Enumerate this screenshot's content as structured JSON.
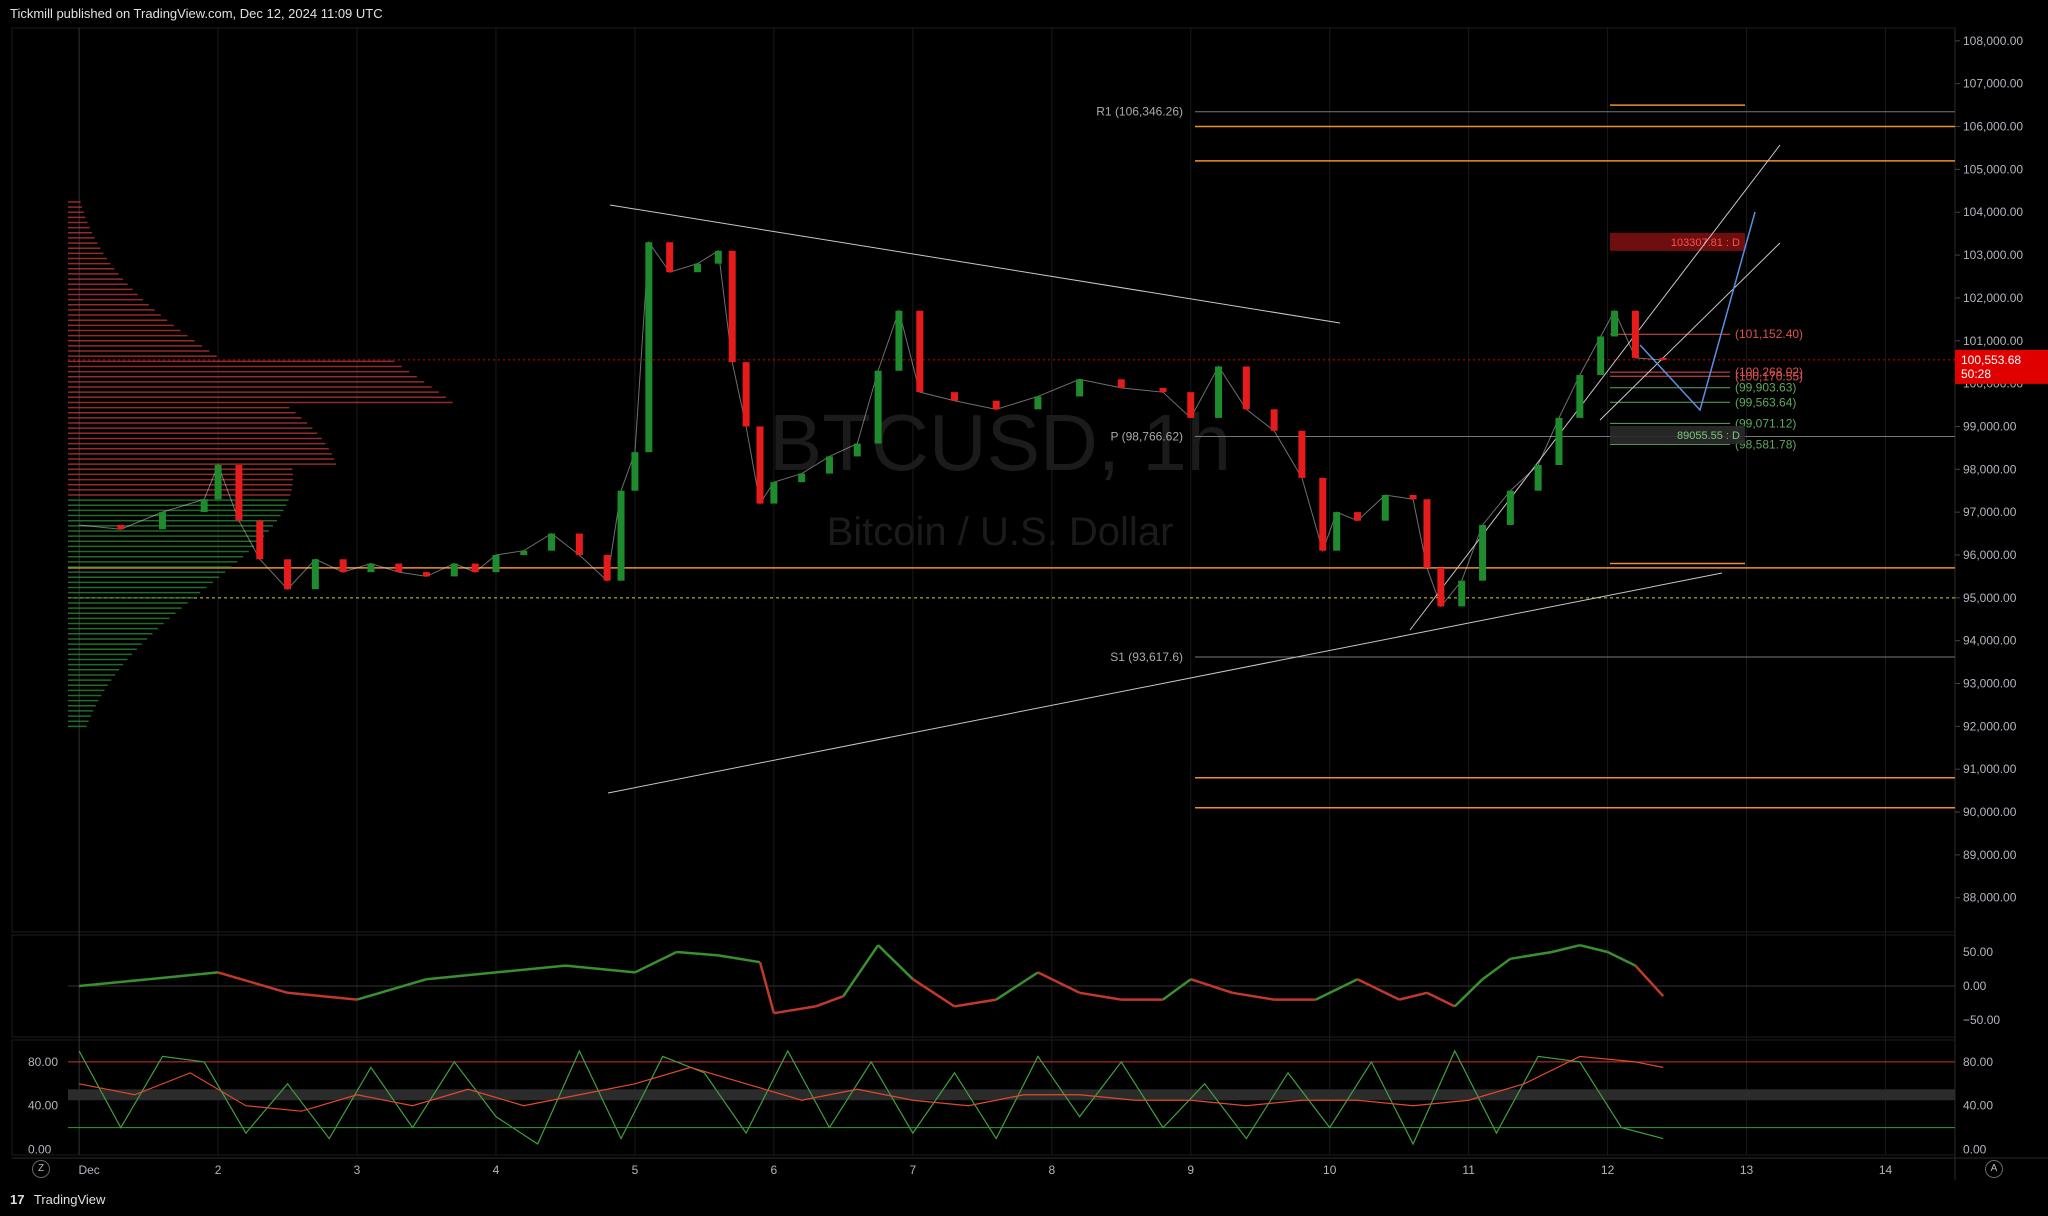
{
  "header": {
    "published": "Tickmill published on TradingView.com, Dec 12, 2024 11:09 UTC"
  },
  "footer": {
    "brand": "TradingView"
  },
  "buttons": {
    "left": "Z",
    "right": "A"
  },
  "colors": {
    "bull": "#1e8c2d",
    "bear": "#e61b1b",
    "price_tag": "#e00000",
    "grid": "#1a1a1a",
    "text": "#b2b5be",
    "orange": "#f0902c",
    "yellow": "#f5c518"
  },
  "chart_data": [
    {
      "type": "line",
      "title": "",
      "watermark": {
        "symbol": "BTCUSD, 1h",
        "name": "Bitcoin / U.S. Dollar"
      },
      "y_ticks": [
        88000,
        89000,
        90000,
        91000,
        92000,
        93000,
        94000,
        95000,
        96000,
        97000,
        98000,
        99000,
        100000,
        101000,
        102000,
        103000,
        104000,
        105000,
        106000,
        107000,
        108000
      ],
      "y_tick_labels": [
        "88,000.00",
        "89,000.00",
        "90,000.00",
        "91,000.00",
        "92,000.00",
        "93,000.00",
        "94,000.00",
        "95,000.00",
        "96,000.00",
        "97,000.00",
        "98,000.00",
        "99,000.00",
        "100,000.00",
        "101,000.00",
        "102,000.00",
        "103,000.00",
        "104,000.00",
        "105,000.00",
        "106,000.00",
        "107,000.00",
        "108,000.00"
      ],
      "ylim": [
        87200,
        108300
      ],
      "x_ticks": [
        "Dec",
        "2",
        "3",
        "4",
        "5",
        "6",
        "7",
        "8",
        "9",
        "10",
        "11",
        "12",
        "13",
        "14"
      ],
      "x_tick_days": [
        1,
        2,
        3,
        4,
        5,
        6,
        7,
        8,
        9,
        10,
        11,
        12,
        13,
        14
      ],
      "xlim": [
        0.92,
        14.5
      ],
      "last_price": {
        "value": 100553.68,
        "label": "100,553.68",
        "countdown": "50:28"
      },
      "series": [
        {
          "x": [
            1.0,
            1.3,
            1.6,
            1.9,
            2.0,
            2.15,
            2.3,
            2.5,
            2.7,
            2.9,
            3.1,
            3.3,
            3.5,
            3.7,
            3.85,
            4.0,
            4.2,
            4.4,
            4.6,
            4.8,
            4.9,
            5.0,
            5.1,
            5.25,
            5.45,
            5.6,
            5.7,
            5.8,
            5.9,
            6.0,
            6.2,
            6.4,
            6.6,
            6.75,
            6.9,
            7.05,
            7.3,
            7.6,
            7.9,
            8.2,
            8.5,
            8.8,
            9.0,
            9.2,
            9.4,
            9.6,
            9.8,
            9.95,
            10.05,
            10.2,
            10.4,
            10.6,
            10.7,
            10.8,
            10.95,
            11.1,
            11.3,
            11.5,
            11.65,
            11.8,
            11.95,
            12.05,
            12.2,
            12.4
          ],
          "values": [
            96700,
            96600,
            97000,
            97300,
            98100,
            96800,
            95900,
            95200,
            95900,
            95600,
            95800,
            95600,
            95500,
            95800,
            95600,
            96000,
            96100,
            96500,
            96000,
            95400,
            97500,
            98400,
            103300,
            102600,
            102800,
            103100,
            100500,
            99000,
            97200,
            97700,
            97900,
            98300,
            98600,
            100300,
            101700,
            99800,
            99600,
            99400,
            99700,
            100100,
            99900,
            99800,
            99200,
            100400,
            99400,
            98900,
            97800,
            96100,
            97000,
            96800,
            97400,
            97300,
            95700,
            94800,
            95400,
            96700,
            97500,
            98100,
            99200,
            100200,
            101100,
            101700,
            100600,
            100550
          ]
        }
      ],
      "levels": [
        {
          "label": "R1 (106,346.26)",
          "value": 106346.26
        },
        {
          "label": "P (98,766.62)",
          "value": 98766.62
        },
        {
          "label": "S1 (93,617.6)",
          "value": 93617.6
        },
        {
          "label": "(101,152.40)",
          "value": 101152.4
        },
        {
          "label": "(100,268.02)",
          "value": 100268.02
        },
        {
          "label": "(100,170.55)",
          "value": 100170.55
        },
        {
          "label": "(99,903.63)",
          "value": 99903.63
        },
        {
          "label": "(99,563.64)",
          "value": 99563.64
        },
        {
          "label": "(99,071.12)",
          "value": 99071.12
        },
        {
          "label": "(98,581.78)",
          "value": 98581.78
        },
        {
          "label": "103307.81 : D",
          "value": 103307.81
        },
        {
          "label": "89055.55 : D",
          "value": 98800
        }
      ]
    },
    {
      "type": "line",
      "y_ticks": [
        50,
        0,
        -50
      ],
      "y_tick_labels": [
        "50.00",
        "0.00",
        "−50.00"
      ],
      "ylim": [
        -75,
        75
      ],
      "series": [
        {
          "x": [
            1.0,
            1.5,
            2.0,
            2.5,
            3.0,
            3.5,
            4.0,
            4.5,
            5.0,
            5.3,
            5.6,
            5.9,
            6.0,
            6.3,
            6.5,
            6.75,
            7.0,
            7.3,
            7.6,
            7.9,
            8.2,
            8.5,
            8.8,
            9.0,
            9.3,
            9.6,
            9.9,
            10.2,
            10.5,
            10.7,
            10.9,
            11.1,
            11.3,
            11.6,
            11.8,
            12.0,
            12.2,
            12.4
          ],
          "values": [
            0,
            10,
            20,
            -10,
            -20,
            10,
            20,
            30,
            20,
            50,
            45,
            35,
            -40,
            -30,
            -15,
            60,
            10,
            -30,
            -20,
            20,
            -10,
            -20,
            -20,
            10,
            -10,
            -20,
            -20,
            10,
            -20,
            -10,
            -30,
            10,
            40,
            50,
            60,
            50,
            30,
            -15
          ]
        }
      ]
    },
    {
      "type": "line",
      "y_ticks": [
        80,
        40,
        0
      ],
      "y_tick_labels_left": [
        "80.00",
        "40.00",
        "0.00"
      ],
      "y_tick_labels_right": [
        "80.00",
        "40.00",
        "0.00"
      ],
      "ylim": [
        -5,
        100
      ],
      "series": [
        {
          "x": [
            1.0,
            1.3,
            1.6,
            1.9,
            2.2,
            2.5,
            2.8,
            3.1,
            3.4,
            3.7,
            4.0,
            4.3,
            4.6,
            4.9,
            5.2,
            5.5,
            5.8,
            6.1,
            6.4,
            6.7,
            7.0,
            7.3,
            7.6,
            7.9,
            8.2,
            8.5,
            8.8,
            9.1,
            9.4,
            9.7,
            10.0,
            10.3,
            10.6,
            10.9,
            11.2,
            11.5,
            11.8,
            12.1,
            12.4
          ],
          "values": [
            90,
            20,
            85,
            80,
            15,
            60,
            10,
            75,
            20,
            80,
            30,
            5,
            90,
            10,
            85,
            70,
            15,
            90,
            20,
            80,
            15,
            70,
            10,
            85,
            30,
            80,
            20,
            60,
            10,
            70,
            20,
            80,
            5,
            90,
            15,
            85,
            80,
            20,
            10
          ]
        },
        {
          "x": [
            1.0,
            1.4,
            1.8,
            2.2,
            2.6,
            3.0,
            3.4,
            3.8,
            4.2,
            4.6,
            5.0,
            5.4,
            5.8,
            6.2,
            6.6,
            7.0,
            7.4,
            7.8,
            8.2,
            8.6,
            9.0,
            9.4,
            9.8,
            10.2,
            10.6,
            11.0,
            11.4,
            11.8,
            12.2,
            12.4
          ],
          "values": [
            60,
            50,
            70,
            40,
            35,
            50,
            40,
            55,
            40,
            50,
            60,
            75,
            60,
            45,
            55,
            45,
            40,
            50,
            50,
            45,
            45,
            40,
            45,
            45,
            40,
            45,
            60,
            85,
            80,
            75
          ]
        }
      ]
    }
  ]
}
